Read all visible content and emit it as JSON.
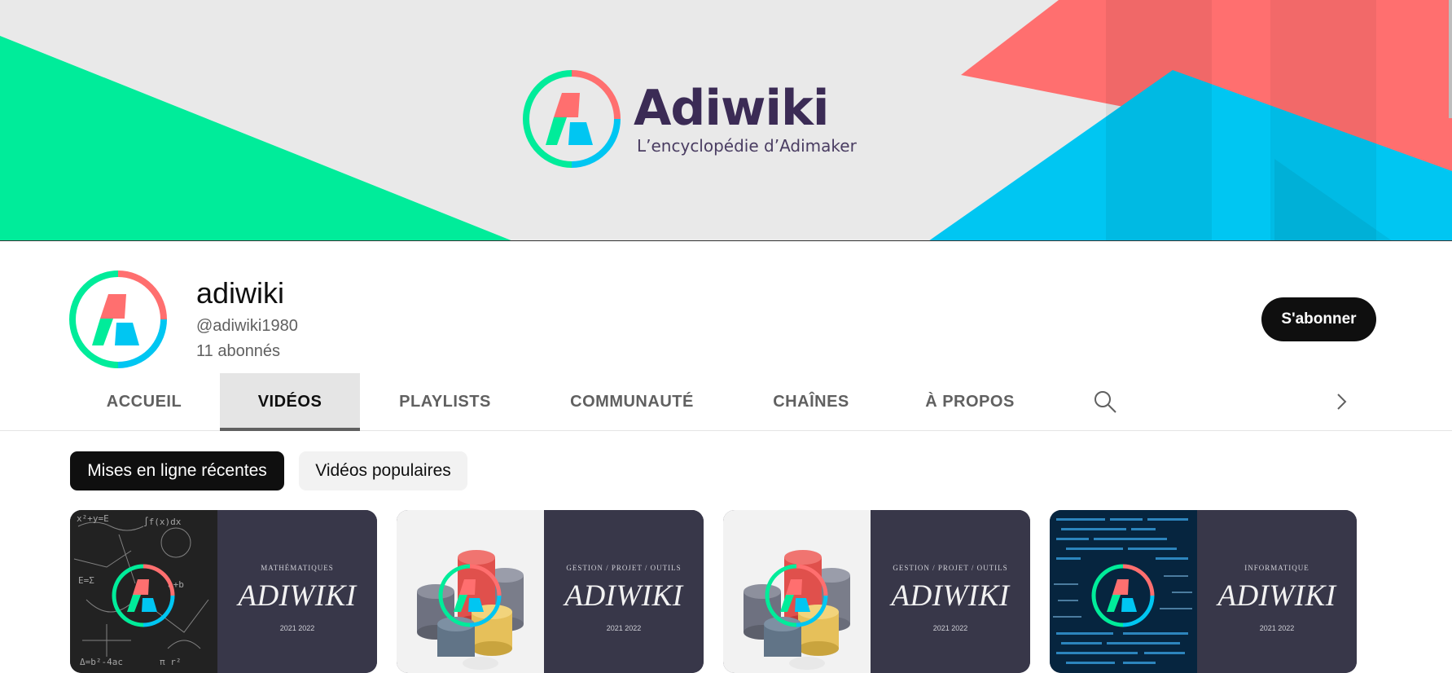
{
  "banner": {
    "brand_name": "Adiwiki",
    "tagline": "L’encyclopédie d’Adimaker"
  },
  "channel": {
    "name": "adiwiki",
    "handle": "@adiwiki1980",
    "subscribers": "11 abonnés",
    "subscribe_label": "S'abonner"
  },
  "tabs": [
    {
      "label": "ACCUEIL",
      "active": false
    },
    {
      "label": "VIDÉOS",
      "active": true
    },
    {
      "label": "PLAYLISTS",
      "active": false
    },
    {
      "label": "COMMUNAUTÉ",
      "active": false
    },
    {
      "label": "CHAÎNES",
      "active": false
    },
    {
      "label": "À PROPOS",
      "active": false
    }
  ],
  "chips": [
    {
      "label": "Mises en ligne récentes",
      "selected": true
    },
    {
      "label": "Vidéos populaires",
      "selected": false
    }
  ],
  "videos": [
    {
      "category": "MATHÉMATIQUES",
      "title": "ADIWIKI",
      "year": "2021 2022",
      "image": "math-formulas-chalkboard"
    },
    {
      "category": "GESTION / PROJET / OUTILS",
      "title": "ADIWIKI",
      "year": "2021 2022",
      "image": "stacked-cylinders"
    },
    {
      "category": "GESTION / PROJET / OUTILS",
      "title": "ADIWIKI",
      "year": "2021 2022",
      "image": "stacked-cylinders"
    },
    {
      "category": "INFORMATIQUE",
      "title": "ADIWIKI",
      "year": "2021 2022",
      "image": "code-screen"
    }
  ],
  "colors": {
    "brand_green": "#00ec9a",
    "brand_red": "#ff6f6f",
    "brand_blue": "#00c6f2",
    "brand_purple": "#3b2b55",
    "thumb_panel": "#383749"
  },
  "icons": {
    "search": "search-icon",
    "next": "chevron-right-icon"
  }
}
